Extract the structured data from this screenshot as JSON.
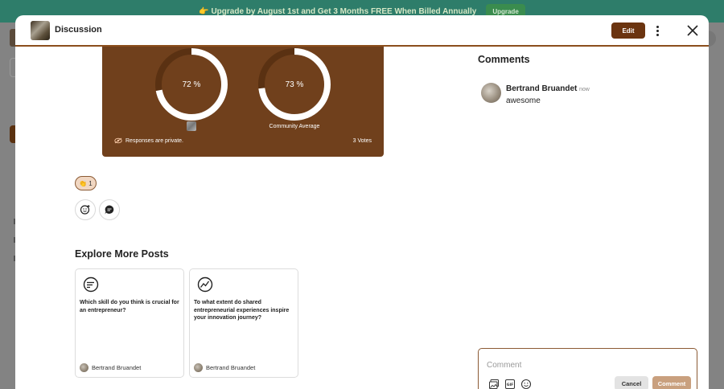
{
  "banner": {
    "text": "👉 Upgrade by August 1st and Get 3 Months FREE When Billed Annually",
    "button": "Upgrade"
  },
  "header": {
    "title": "Discussion",
    "edit_label": "Edit"
  },
  "poll": {
    "user_percent": "72 %",
    "user_fraction": 0.72,
    "community_percent": "73 %",
    "community_fraction": 0.73,
    "community_label": "Community Average",
    "private_text": "Responses are private.",
    "votes": "3 Votes"
  },
  "reactions": {
    "count": "1"
  },
  "explore": {
    "title": "Explore More Posts",
    "posts": [
      {
        "text": "Which skill do you think is crucial for an entrepreneur?",
        "author": "Bertrand Bruandet"
      },
      {
        "text": "To what extent do shared entrepreneurial experiences inspire your innovation journey?",
        "author": "Bertrand Bruandet"
      }
    ]
  },
  "comments": {
    "title": "Comments",
    "items": [
      {
        "author": "Bertrand Bruandet",
        "time": "now",
        "body": "awesome"
      }
    ],
    "composer": {
      "placeholder": "Comment",
      "cancel_label": "Cancel",
      "submit_label": "Comment"
    }
  }
}
